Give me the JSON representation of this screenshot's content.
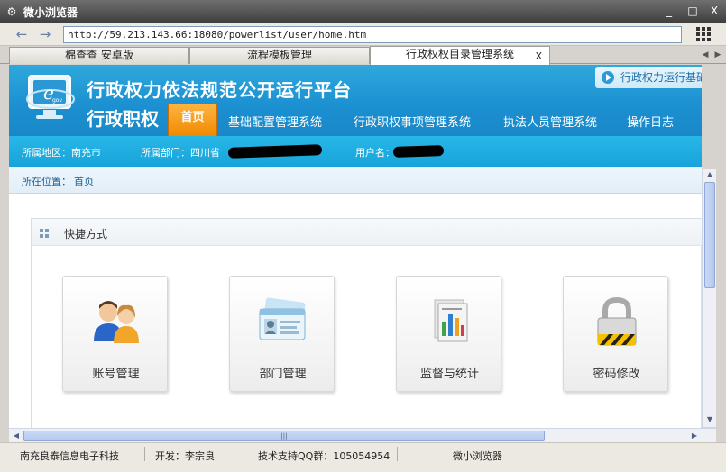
{
  "window": {
    "title": "微小浏览器",
    "minimize": "_",
    "maximize": "□",
    "close": "X"
  },
  "nav": {
    "back": "←",
    "forward": "→",
    "url": "http://59.213.143.66:18080/powerlist/user/home.htm"
  },
  "tabs": [
    {
      "label": "棉查查 安卓版",
      "active": false
    },
    {
      "label": "流程模板管理",
      "active": false
    },
    {
      "label": "行政权权目录管理系统",
      "active": true,
      "close": "X"
    }
  ],
  "tab_scroll": {
    "left": "◀",
    "right": "▶"
  },
  "banner": {
    "title": "行政权力依法规范公开运行平台",
    "subtitle": "行政职权",
    "right_link": "行政权力运行基础",
    "logo_text": "e",
    "logo_sub": "gov"
  },
  "menu": {
    "home": "首页",
    "items": [
      "基础配置管理系统",
      "行政职权事项管理系统",
      "执法人员管理系统",
      "操作日志"
    ]
  },
  "info": {
    "region": "所属地区：南充市",
    "dept": "所属部门：四川省",
    "user": "用户名："
  },
  "breadcrumb": {
    "label": "所在位置：",
    "current": "首页"
  },
  "shortcuts": {
    "title": "快捷方式",
    "items": [
      {
        "label": "账号管理",
        "icon": "users-icon"
      },
      {
        "label": "部门管理",
        "icon": "id-card-icon"
      },
      {
        "label": "监督与统计",
        "icon": "report-chart-icon"
      },
      {
        "label": "密码修改",
        "icon": "padlock-icon"
      }
    ]
  },
  "hscroll_grip": "|||",
  "status": {
    "company": "南充良泰信息电子科技",
    "developer": "开发：李宗良",
    "support": "技术支持QQ群：105054954",
    "app": "微小浏览器"
  },
  "colors": {
    "banner_blue": "#1b8fd0",
    "home_orange": "#f08a00",
    "info_blue": "#16a4da"
  }
}
